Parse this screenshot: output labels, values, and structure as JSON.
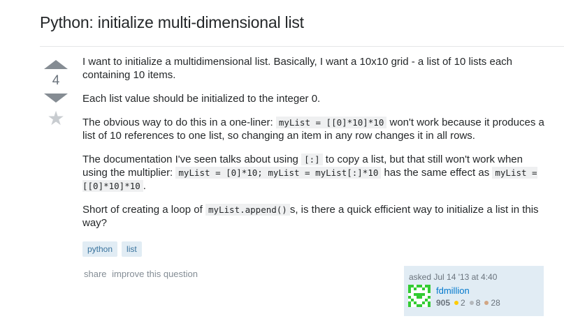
{
  "question": {
    "title": "Python: initialize multi-dimensional list",
    "votes": "4",
    "body": {
      "p1": "I want to initialize a multidimensional list. Basically, I want a 10x10 grid - a list of 10 lists each containing 10 items.",
      "p2": "Each list value should be initialized to the integer 0.",
      "p3_a": "The obvious way to do this in a one-liner: ",
      "p3_code": "myList = [[0]*10]*10",
      "p3_b": " won't work because it produces a list of 10 references to one list, so changing an item in any row changes it in all rows.",
      "p4_a": "The documentation I've seen talks about using ",
      "p4_code1": "[:]",
      "p4_b": " to copy a list, but that still won't work when using the multiplier: ",
      "p4_code2": "myList = [0]*10; myList = myList[:]*10",
      "p4_c": " has the same effect as ",
      "p4_code3": "myList = [[0]*10]*10",
      "p4_d": ".",
      "p5_a": "Short of creating a loop of ",
      "p5_code": "myList.append()",
      "p5_b": "s, is there a quick efficient way to initialize a list in this way?"
    },
    "tags": [
      "python",
      "list"
    ],
    "menu": {
      "share": "share",
      "improve": "improve this question"
    },
    "owner": {
      "asked": "asked Jul 14 '13 at 4:40",
      "username": "fdmillion",
      "reputation": "905",
      "gold": "2",
      "silver": "8",
      "bronze": "28"
    }
  },
  "colors": {
    "gold": "#ffcc01",
    "silver": "#b4b8bc",
    "bronze": "#d1a684",
    "avatar": "#33cc33"
  }
}
